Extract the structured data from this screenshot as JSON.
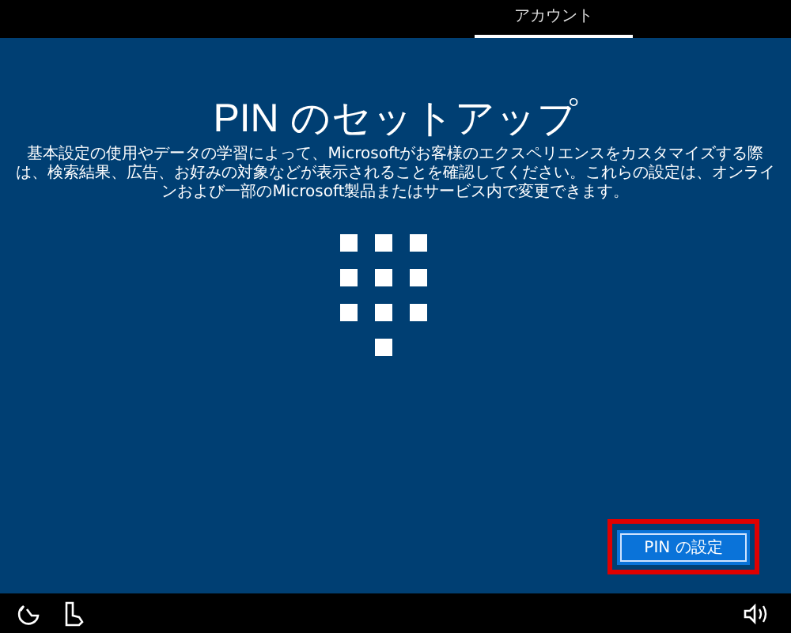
{
  "tabs": [
    {
      "label": "アカウント",
      "selected": true
    }
  ],
  "title": "PIN のセットアップ",
  "description": "基本設定の使用やデータの学習によって、Microsoftがお客様のエクスペリエンスをカスタマイズする際は、検索結果、広告、お好みの対象などが表示されることを確認してください。これらの設定は、オンラインおよび一部のMicrosoft製品またはサービス内で変更できます。",
  "button": {
    "label": "PIN の設定",
    "highlighted": true
  }
}
